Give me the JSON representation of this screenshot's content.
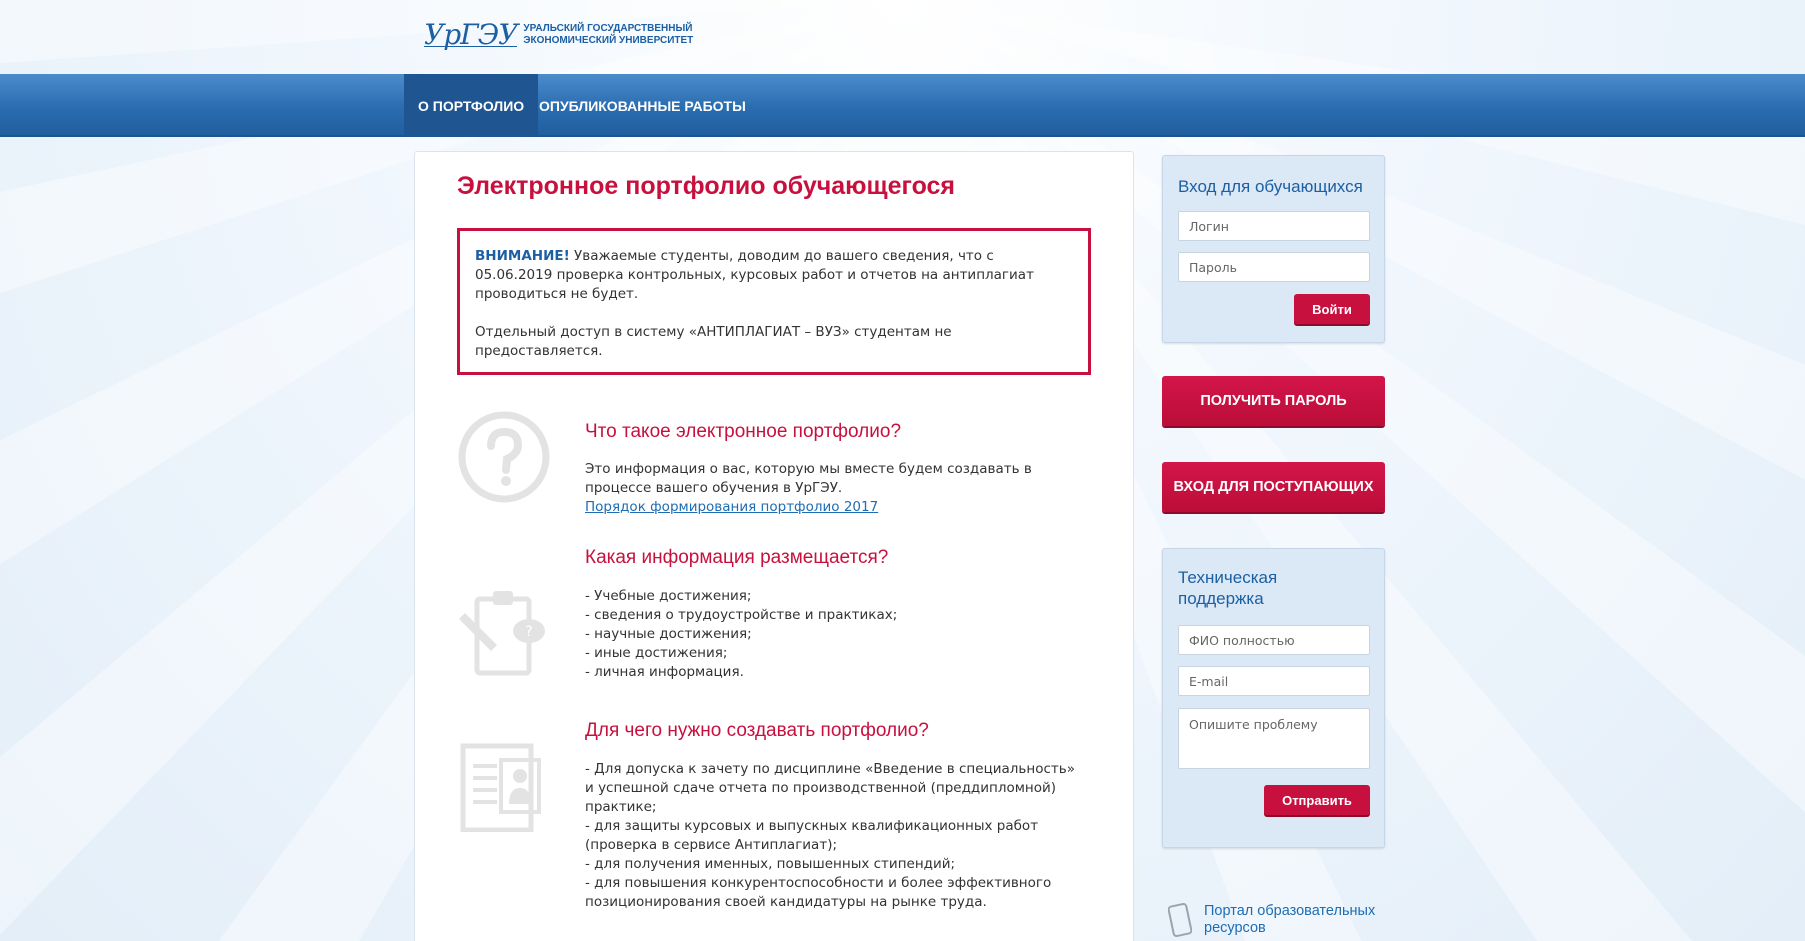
{
  "header": {
    "logo_mark": "УрГЭУ",
    "logo_line1": "Уральский государственный",
    "logo_line2": "экономический университет"
  },
  "nav": {
    "items": [
      {
        "label": "О портфолио",
        "active": true
      },
      {
        "label": "Опубликованные работы",
        "active": false
      }
    ]
  },
  "main": {
    "title": "Электронное портфолио обучающегося",
    "notice": {
      "strong": "ВНИМАНИЕ!",
      "text": " Уважаемые студенты, доводим до вашего сведения, что с 05.06.2019 проверка контрольных, курсовых работ и отчетов на антиплагиат проводиться не будет.",
      "text2": "Отдельный доступ в систему «АНТИПЛАГИАТ – ВУЗ» студентам не предоставляется."
    },
    "sections": [
      {
        "title": "Что такое электронное портфолио?",
        "icon": "question-icon",
        "text": "Это информация о вас, которую мы вместе будем создавать в процессе вашего обучения в УрГЭУ.",
        "link": "Порядок формирования портфолио 2017"
      },
      {
        "title": "Какая информация размещается?",
        "icon": "clipboard-icon",
        "lines": [
          "- Учебные достижения;",
          "- сведения о трудоустройстве и практиках;",
          "- научные достижения;",
          "- иные достижения;",
          "- личная информация."
        ]
      },
      {
        "title": "Для чего нужно создавать портфолио?",
        "icon": "certificate-icon",
        "lines": [
          "- Для допуска к зачету по дисциплине «Введение в специальность» и успешной сдаче отчета по производственной (преддипломной) практике;",
          "- для защиты курсовых и выпускных квалификационных работ (проверка в сервисе Антиплагиат);",
          "- для получения именных, повышенных стипендий;",
          "- для повышения конкурентоспособности и более эффективного позиционирования своей кандидатуры на рынке труда."
        ]
      }
    ]
  },
  "sidebar": {
    "login": {
      "title": "Вход для обучающихся",
      "login_placeholder": "Логин",
      "password_placeholder": "Пароль",
      "button": "Войти"
    },
    "get_password": "Получить пароль",
    "applicants": "Вход для поступающих",
    "support": {
      "title": "Техническая поддержка",
      "name_placeholder": "ФИО полностью",
      "email_placeholder": "E-mail",
      "problem_placeholder": "Опишите проблему",
      "button": "Отправить"
    },
    "portal_link": "Портал образовательных ресурсов"
  },
  "colors": {
    "accent": "#c8103e",
    "brand": "#1d5fa3",
    "nav": "#2a6db0"
  }
}
